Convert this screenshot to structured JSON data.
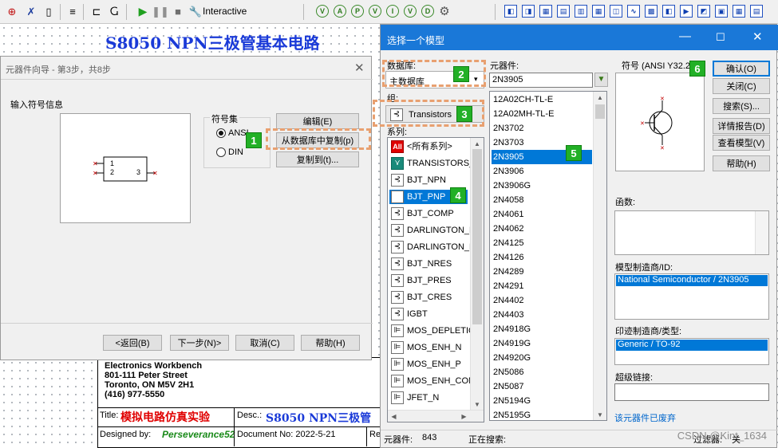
{
  "toolbar": {
    "interactive_label": "Interactive"
  },
  "schematic": {
    "title": "S8050 NPN三极管基本电路",
    "company_lines": [
      "Electronics Workbench",
      "801-111 Peter Street",
      "Toronto, ON M5V 2H1",
      "(416) 977-5550"
    ],
    "title_label": "Title:",
    "title_value": "模拟电路仿真实验",
    "desc_label": "Desc.:",
    "desc_value": "S8050 NPN三极管",
    "designed_by_label": "Designed by:",
    "designed_by_value": "Perseverance52",
    "doc_no": "Document No: 2022-5-21",
    "rev_label": "Re"
  },
  "wizard": {
    "title": "元器件向导 - 第3步，共8步",
    "input_symbol_label": "输入符号信息",
    "symbol_set_label": "符号集",
    "ansi_label": "ANSI",
    "din_label": "DIN",
    "edit_button": "编辑(E)",
    "copy_from_db_button": "从数据库中复制(p)",
    "copy_to_button": "复制到(t)...",
    "preview_pin1": "1",
    "preview_pin2": "2",
    "preview_pin3": "3",
    "back_button": "<返回(B)",
    "next_button": "下一步(N)>",
    "cancel_button": "取消(C)",
    "help_button": "帮助(H)"
  },
  "chooser": {
    "title": "选择一个模型",
    "database_label": "数据库:",
    "database_value": "主数据库",
    "group_label": "组:",
    "group_value": "Transistors",
    "family_label": "系列:",
    "families": [
      {
        "label": "<所有系列>",
        "icon": "all-icon",
        "icon_text": "All"
      },
      {
        "label": "TRANSISTORS_",
        "icon": "transistors-family-icon",
        "icon_text": "⋎"
      },
      {
        "label": "BJT_NPN",
        "icon": "bjt-npn-icon",
        "icon_text": "⊰"
      },
      {
        "label": "BJT_PNP",
        "icon": "bjt-pnp-icon",
        "icon_text": "⊰"
      },
      {
        "label": "BJT_COMP",
        "icon": "bjt-comp-icon",
        "icon_text": "⊰"
      },
      {
        "label": "DARLINGTON_N",
        "icon": "darlington-n-icon",
        "icon_text": "⊰"
      },
      {
        "label": "DARLINGTON_P",
        "icon": "darlington-p-icon",
        "icon_text": "⊰"
      },
      {
        "label": "BJT_NRES",
        "icon": "bjt-nres-icon",
        "icon_text": "⊰"
      },
      {
        "label": "BJT_PRES",
        "icon": "bjt-pres-icon",
        "icon_text": "⊰"
      },
      {
        "label": "BJT_CRES",
        "icon": "bjt-cres-icon",
        "icon_text": "⊰"
      },
      {
        "label": "IGBT",
        "icon": "igbt-icon",
        "icon_text": "⊰"
      },
      {
        "label": "MOS_DEPLETIO",
        "icon": "mos-depletion-icon",
        "icon_text": "⊫"
      },
      {
        "label": "MOS_ENH_N",
        "icon": "mos-enh-n-icon",
        "icon_text": "⊫"
      },
      {
        "label": "MOS_ENH_P",
        "icon": "mos-enh-p-icon",
        "icon_text": "⊫"
      },
      {
        "label": "MOS_ENH_COM",
        "icon": "mos-enh-com-icon",
        "icon_text": "⊫"
      },
      {
        "label": "JFET_N",
        "icon": "jfet-n-icon",
        "icon_text": "⊫"
      }
    ],
    "selected_family_index": 3,
    "component_label": "元器件:",
    "component_value": "2N3905",
    "components": [
      "12A02CH-TL-E",
      "12A02MH-TL-E",
      "2N3702",
      "2N3703",
      "2N3905",
      "2N3906",
      "2N3906G",
      "2N4058",
      "2N4061",
      "2N4062",
      "2N4125",
      "2N4126",
      "2N4289",
      "2N4291",
      "2N4402",
      "2N4403",
      "2N4918G",
      "2N4919G",
      "2N4920G",
      "2N5086",
      "2N5087",
      "2N5194G",
      "2N5195G"
    ],
    "selected_component_index": 4,
    "symbol_label": "符号 (ANSI Y32.2",
    "ok_button": "确认(O)",
    "close_button": "关闭(C)",
    "search_button": "搜索(S)...",
    "detail_button": "详情报告(D)",
    "view_model_button": "查看模型(V)",
    "help_button": "帮助(H)",
    "function_label": "函数:",
    "model_maker_label": "模型制造商/ID:",
    "model_maker_value": "National Semiconductor / 2N3905",
    "footprint_label": "印迹制造商/类型:",
    "footprint_value": "Generic / TO-92",
    "hyperlink_label": "超级链接:",
    "deprecated_link": "该元器件已废弃",
    "status_count_label": "元器件:",
    "status_count_value": "843",
    "status_search_label": "正在搜索:",
    "status_filter_label": "过滤器:",
    "status_filter_value": "关"
  },
  "badges": [
    "1",
    "2",
    "3",
    "4",
    "5",
    "6"
  ],
  "watermark": "CSDN @Kint_1634",
  "colors": {
    "selection": "#0078d7",
    "badge": "#22b026",
    "highlight": "#e8a070",
    "title_blue": "#1a3ad8",
    "title_red": "#e00000"
  }
}
